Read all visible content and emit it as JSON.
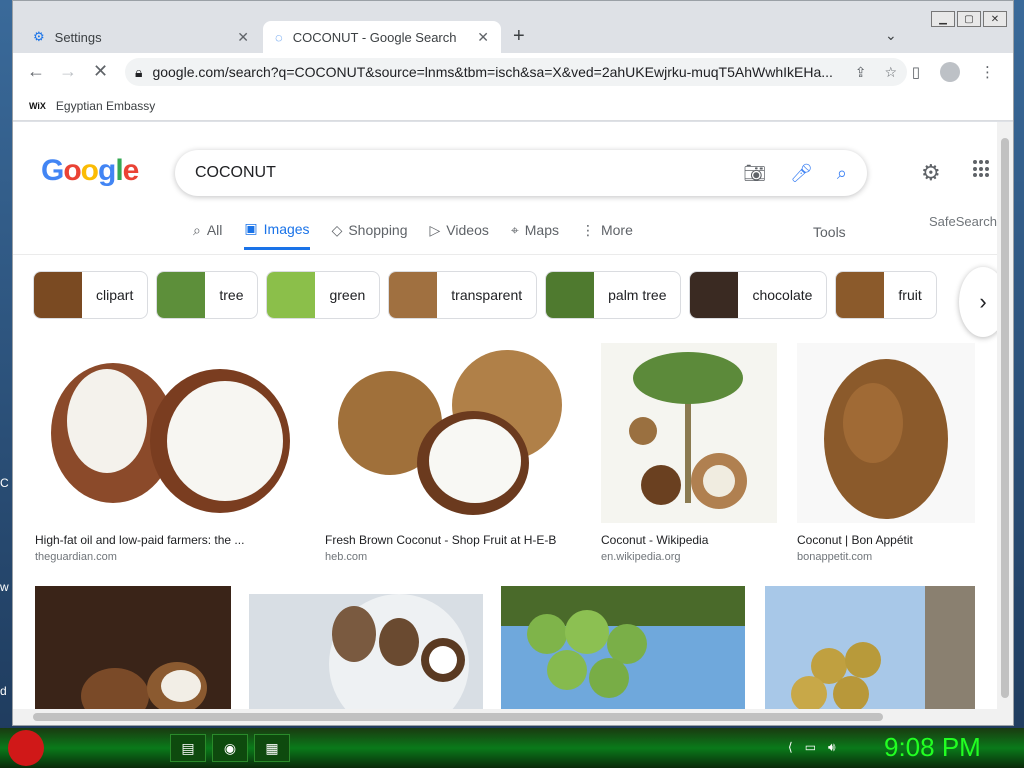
{
  "browser": {
    "tabs": [
      {
        "label": "Settings",
        "icon": "gear-icon",
        "active": false
      },
      {
        "label": "COCONUT - Google Search",
        "icon": "loading-icon",
        "active": true
      }
    ],
    "url": "google.com/search?q=COCONUT&source=lnms&tbm=isch&sa=X&ved=2ahUKEwjrku-muqT5AhWwhIkEHa...",
    "bookmarks": [
      {
        "icon_text": "WiX",
        "label": "Egyptian Embassy"
      }
    ]
  },
  "google": {
    "logo": "Google",
    "query": "COCONUT",
    "nav_tabs": [
      {
        "label": "All",
        "icon": "search-icon",
        "selected": false
      },
      {
        "label": "Images",
        "icon": "image-icon",
        "selected": true
      },
      {
        "label": "Shopping",
        "icon": "tag-icon",
        "selected": false
      },
      {
        "label": "Videos",
        "icon": "play-icon",
        "selected": false
      },
      {
        "label": "Maps",
        "icon": "pin-icon",
        "selected": false
      },
      {
        "label": "More",
        "icon": "more-vert-icon",
        "selected": false
      }
    ],
    "tools": "Tools",
    "safesearch": "SafeSearch",
    "chips": [
      {
        "label": "clipart",
        "color": "#7a4a22"
      },
      {
        "label": "tree",
        "color": "#5d8f3a"
      },
      {
        "label": "green",
        "color": "#8bbf4a"
      },
      {
        "label": "transparent",
        "color": "#a07040"
      },
      {
        "label": "palm tree",
        "color": "#4f7a2f"
      },
      {
        "label": "chocolate",
        "color": "#3a2a22"
      },
      {
        "label": "fruit",
        "color": "#8b5a2b"
      }
    ],
    "results": [
      {
        "title": "High-fat oil and low-paid farmers: the ...",
        "source": "theguardian.com",
        "color": "#8b4a2a"
      },
      {
        "title": "Fresh Brown Coconut - Shop Fruit at H-E-B",
        "source": "heb.com",
        "color": "#a0703a"
      },
      {
        "title": "Coconut - Wikipedia",
        "source": "en.wikipedia.org",
        "color": "#6f8a3a"
      },
      {
        "title": "Coconut | Bon Appétit",
        "source": "bonappetit.com",
        "color": "#8b5a2b"
      },
      {
        "title": "",
        "source": "",
        "color": "#4a3020"
      },
      {
        "title": "",
        "source": "",
        "color": "#7a5a40"
      },
      {
        "title": "",
        "source": "",
        "color": "#5f9a3a"
      },
      {
        "title": "",
        "source": "",
        "color": "#9a8a3a"
      }
    ]
  },
  "taskbar": {
    "clock": "9:08 PM"
  },
  "desktop": {
    "edge_letters": [
      "C",
      "w",
      "d"
    ]
  }
}
